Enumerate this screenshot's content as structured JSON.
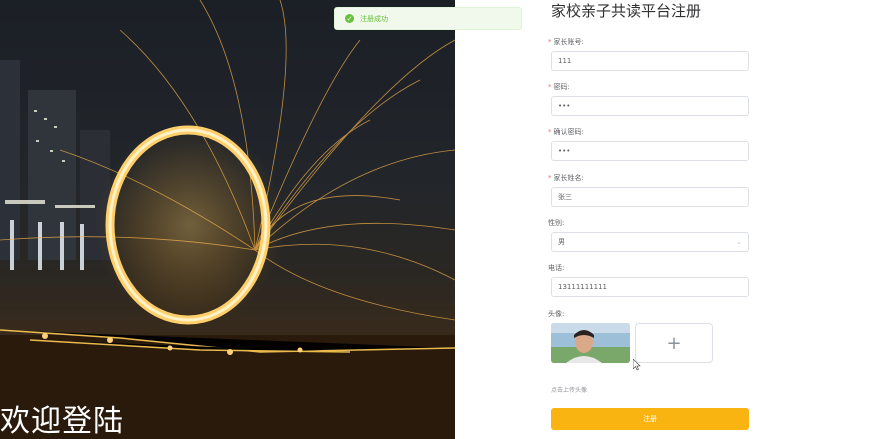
{
  "hero": {
    "welcome_text": "欢迎登陆"
  },
  "toast": {
    "message": "注册成功"
  },
  "form": {
    "title": "家校亲子共读平台注册",
    "fields": [
      {
        "label": "家长账号:",
        "required": true,
        "value": "111"
      },
      {
        "label": "密码:",
        "required": true,
        "value": "•••"
      },
      {
        "label": "确认密码:",
        "required": true,
        "value": "•••"
      },
      {
        "label": "家长姓名:",
        "required": true,
        "value": "张三"
      },
      {
        "label": "性别:",
        "required": false,
        "value": "男"
      },
      {
        "label": "电话:",
        "required": false,
        "value": "13111111111"
      }
    ],
    "avatar_label": "头像:",
    "upload_plus": "+",
    "upload_tip": "点击上传头像",
    "submit_label": "注册"
  },
  "colors": {
    "primary": "#f9b412",
    "success": "#67c23a",
    "required": "#f56c6c"
  },
  "icons": {
    "toast": "check-circle-icon",
    "select": "chevron-down-icon",
    "upload": "plus-icon"
  }
}
